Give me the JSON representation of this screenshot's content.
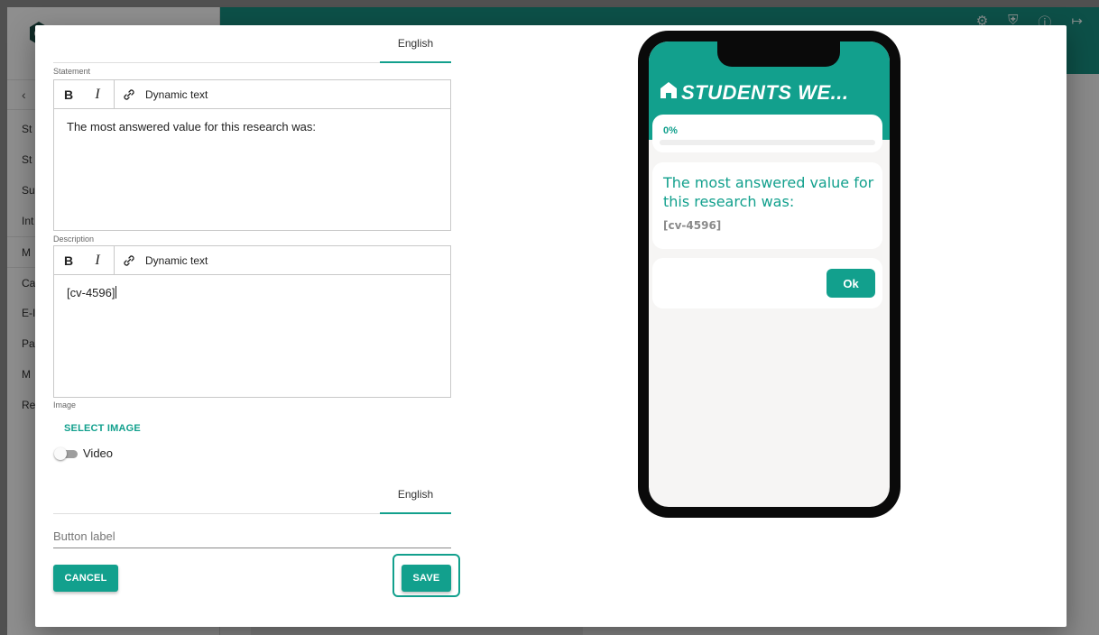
{
  "background": {
    "sidebar_items": [
      "St",
      "St",
      "Su",
      "Int",
      "M",
      "Ca",
      "E-I",
      "Pa",
      "M",
      "Re"
    ]
  },
  "dialog": {
    "top_tabs": {
      "active": "English"
    },
    "statement": {
      "label": "Statement",
      "toolbar": {
        "bold": "B",
        "italic": "I",
        "dynamic": "Dynamic text"
      },
      "text": "The most answered value for this research was:"
    },
    "description": {
      "label": "Description",
      "toolbar": {
        "bold": "B",
        "italic": "I",
        "dynamic": "Dynamic text"
      },
      "text": "[cv-4596]"
    },
    "image": {
      "label": "Image",
      "select_button": "SELECT IMAGE"
    },
    "video": {
      "label": "Video",
      "enabled": false
    },
    "button_tabs": {
      "active": "English"
    },
    "button_label_input": {
      "placeholder": "Button label",
      "value": ""
    },
    "actions": {
      "cancel": "CANCEL",
      "save": "SAVE"
    }
  },
  "preview": {
    "app_title": "STUDENTS WE...",
    "progress_text": "0%",
    "progress_value": 0,
    "question": "The most answered value for this research was:",
    "description": "[cv-4596]",
    "ok_button": "Ok"
  },
  "colors": {
    "accent": "#12a08d",
    "topbar": "#178a7d"
  }
}
